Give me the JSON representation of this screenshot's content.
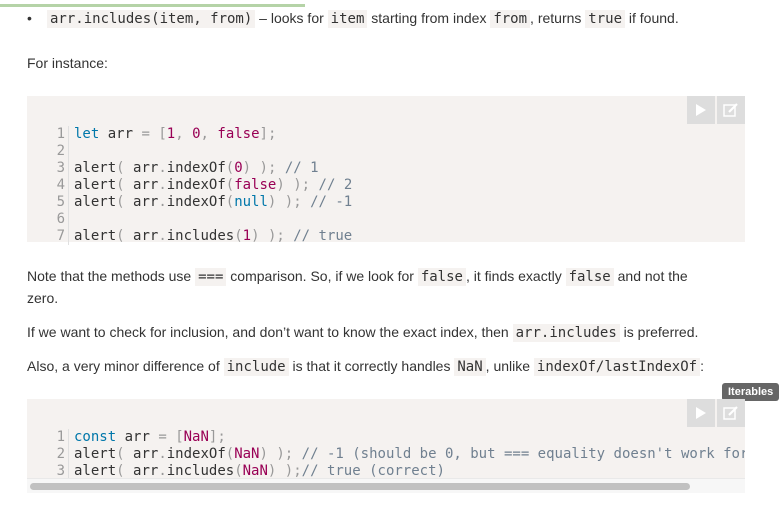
{
  "bullet": {
    "symbol": "•",
    "code1": "arr.includes(item, from)",
    "text1": " – looks for ",
    "code2": "item",
    "text2": " starting from index ",
    "code3": "from",
    "text3": ", returns ",
    "code4": "true",
    "text4": " if found."
  },
  "for_instance": "For instance:",
  "code1": {
    "lines": [
      {
        "n": "1",
        "text": "let arr = [1, 0, false];"
      },
      {
        "n": "2",
        "text": ""
      },
      {
        "n": "3",
        "text": "alert( arr.indexOf(0) ); // 1"
      },
      {
        "n": "4",
        "text": "alert( arr.indexOf(false) ); // 2"
      },
      {
        "n": "5",
        "text": "alert( arr.indexOf(null) ); // -1"
      },
      {
        "n": "6",
        "text": ""
      },
      {
        "n": "7",
        "text": "alert( arr.includes(1) ); // true"
      }
    ]
  },
  "note": {
    "p1": "Note that the methods use ",
    "c1": "===",
    "p2": " comparison. So, if we look for ",
    "c2": "false",
    "p3": ", it finds exactly ",
    "c3": "false",
    "p4": " and not the",
    "p5": "zero."
  },
  "check": {
    "p1": "If we want to check for inclusion, and don’t want to know the exact index, then ",
    "c1": "arr.includes",
    "p2": " is preferred."
  },
  "also": {
    "p1": "Also, a very minor difference of ",
    "c1": "include",
    "p2": " is that it correctly handles ",
    "c2": "NaN",
    "p3": ", unlike ",
    "c3": "indexOf/lastIndexOf",
    "p4": ":"
  },
  "tooltip": "Iterables",
  "code2": {
    "lines": [
      {
        "n": "1",
        "text": "const arr = [NaN];"
      },
      {
        "n": "2",
        "text": "alert( arr.indexOf(NaN) ); // -1 (should be 0, but === equality doesn't work for"
      },
      {
        "n": "3",
        "text": "alert( arr.includes(NaN) );// true (correct)"
      }
    ]
  },
  "icons": {
    "run": "play-icon",
    "edit": "edit-icon"
  },
  "colors": {
    "code_bg": "#f5f2f0",
    "keyword": "#0077aa",
    "number": "#990055",
    "comment": "#708090"
  }
}
